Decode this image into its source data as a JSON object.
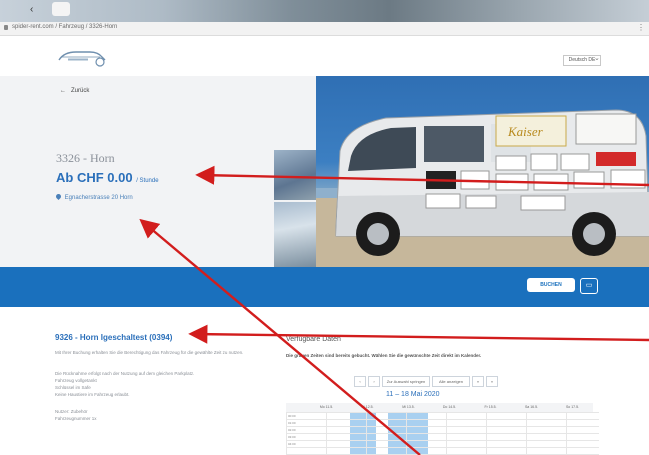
{
  "browser": {
    "nav_back": "‹",
    "tab_label": "",
    "address": "spider-rent.com / Fahrzeug / 3326-Horn",
    "menu": "⋮"
  },
  "header": {
    "lang_select": "Deutsch DE",
    "lang_chevron": "⌄"
  },
  "hero": {
    "back_label": "Zurück",
    "back_arrow": "←",
    "title": "3326 - Horn",
    "price": "Ab CHF 0.00",
    "price_unit": "/ Stunde",
    "location": "Egnacherstrasse 20 Horn"
  },
  "booking": {
    "book_label": "BUCHEN",
    "icon_label": "▭"
  },
  "description": {
    "title": "9326 - Horn Igeschaltest (0394)",
    "p1": "Mit Ihrer Buchung erhalten Sie die Berechtigung das Fahrzeug für die gewählte Zeit zu nutzen.",
    "p2": "Die Rücknahme erfolgt nach der Nutzung auf dem gleichen Parkplatz.",
    "p3a": "Fahrzeug vollgetankt",
    "p3b": "Schlüssel im Safe",
    "p3c": "Keine Haustiere im Fahrzeug erlaubt.",
    "p4a": "Nutzer: Zubehör",
    "p4b": "Fahrzeugnummer 1x"
  },
  "availability": {
    "title": "Verfügbare Daten",
    "subtitle": "Die grauen Zeiten sind bereits gebucht. Wählen Sie die gewünschte Zeit direkt im Kalender.",
    "controls": [
      "‹",
      "›",
      "Zur Auswahl springen",
      "Alle anzeigen",
      "«",
      "»"
    ],
    "date_range": "11 – 18 Mai 2020",
    "days": [
      "Mo 11.5.",
      "Di 12.5.",
      "Mi 13.5.",
      "Do 14.5.",
      "Fr 15.5.",
      "Sa 16.5.",
      "So 17.5."
    ],
    "times": [
      "00:00",
      "01:00",
      "02:00",
      "03:00",
      "04:00"
    ]
  },
  "colors": {
    "brand_blue": "#1a70bd",
    "price_blue": "#2a6fba",
    "annotation_red": "#d21d1d"
  }
}
